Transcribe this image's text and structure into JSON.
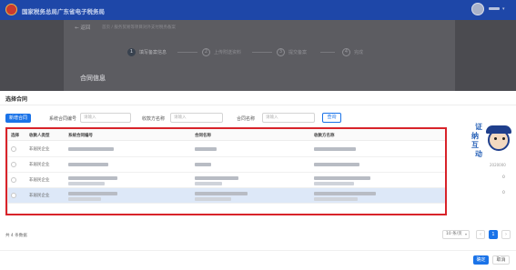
{
  "app": {
    "title": "国家税务总局广东省电子税务局"
  },
  "background": {
    "back_label": "← 返回",
    "breadcrumb": "首页 / 服务贸易等项目对外支付税务备案",
    "section_title": "合同信息",
    "steps": [
      {
        "num": "1",
        "label": "填写备案信息"
      },
      {
        "num": "2",
        "label": "上传附送资料"
      },
      {
        "num": "3",
        "label": "提交备案"
      },
      {
        "num": "4",
        "label": "完成"
      }
    ]
  },
  "modal": {
    "title": "选择合同",
    "add_button": "新增合同",
    "filters": [
      {
        "label": "系统合同编号",
        "placeholder": "请输入"
      },
      {
        "label": "收款方名称",
        "placeholder": "请输入"
      },
      {
        "label": "合同名称",
        "placeholder": "请输入"
      }
    ],
    "query_button": "查询",
    "table": {
      "columns": [
        "选择",
        "收款人类型",
        "系统合同编号",
        "合同名称",
        "收款方名称"
      ],
      "rows": [
        {
          "type": "非居民企业",
          "selected": false
        },
        {
          "type": "非居民企业",
          "selected": false
        },
        {
          "type": "非居民企业",
          "selected": false
        },
        {
          "type": "非居民企业",
          "selected": true
        }
      ]
    },
    "side_values": {
      "amount": "2020000",
      "zero1": "0",
      "zero2": "0"
    },
    "mascot": {
      "chars": [
        "证",
        "纳",
        "互",
        "动"
      ]
    },
    "pager": {
      "total": "共 4 条数据",
      "page_size": "10 条/页",
      "current_page": "1",
      "prev": "‹",
      "next": "›"
    },
    "confirm_button": "确定",
    "cancel_button": "取消"
  },
  "colors": {
    "accent": "#1a73e8",
    "header": "#1e47a8",
    "highlight": "#d8232a"
  }
}
